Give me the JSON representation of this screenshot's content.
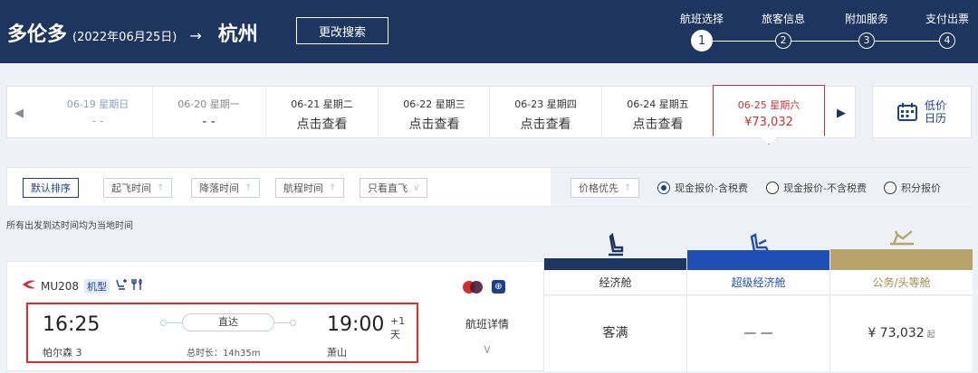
{
  "header": {
    "origin": "多伦多",
    "date": "(2022年06月25日)",
    "arrow": "→",
    "destination": "杭州",
    "change_search": "更改搜索",
    "steps": [
      {
        "label": "航班选择",
        "num": "1"
      },
      {
        "label": "旅客信息",
        "num": "2"
      },
      {
        "label": "附加服务",
        "num": "3"
      },
      {
        "label": "支付出票",
        "num": "4"
      }
    ]
  },
  "date_strip": {
    "prev_icon": "◀",
    "next_icon": "▶",
    "days": [
      {
        "label": "06-19 星期日",
        "value": "- -"
      },
      {
        "label": "06-20 星期一",
        "value": "- -"
      },
      {
        "label": "06-21 星期二",
        "value": "点击查看"
      },
      {
        "label": "06-22 星期三",
        "value": "点击查看"
      },
      {
        "label": "06-23 星期四",
        "value": "点击查看"
      },
      {
        "label": "06-24 星期五",
        "value": "点击查看"
      },
      {
        "label": "06-25 星期六",
        "value": "¥73,032"
      }
    ],
    "calendar_line1": "低价",
    "calendar_line2": "日历"
  },
  "filters": {
    "default_sort": "默认排序",
    "departure_time": "起飞时间",
    "arrival_time": "降落时间",
    "duration": "航程时间",
    "direct_only": "只看直飞",
    "price_first": "价格优先",
    "up_arrow": "↑",
    "down_chevron": "∨",
    "radios": [
      {
        "label": "现金报价-含税费",
        "selected": true
      },
      {
        "label": "现金报价-不含税费",
        "selected": false
      },
      {
        "label": "积分报价",
        "selected": false
      }
    ]
  },
  "note": "所有出发到达时间均为当地时间",
  "flight": {
    "flight_number": "MU208",
    "aircraft_tag": "机型",
    "dep_time": "16:25",
    "dep_airport": "帕尔森 3",
    "direct": "直达",
    "total_duration": "总时长：14h35m",
    "arr_time": "19:00",
    "plus_day": "+1 天",
    "arr_airport": "萧山",
    "details": "航班详情",
    "details_chevron": "∨"
  },
  "cabins": [
    {
      "name": "经济舱",
      "value": "客满",
      "bar_color": "#1e3560"
    },
    {
      "name": "超级经济舱",
      "value": "— —",
      "bar_color": "#1f4fb5"
    },
    {
      "name": "公务/头等舱",
      "value": "¥ 73,032",
      "suffix": "起",
      "bar_color": "#b8a36a"
    }
  ],
  "colors": {
    "header_bg": "#1e3560",
    "accent": "#1e3f8c",
    "selected_red": "#c8323a"
  }
}
